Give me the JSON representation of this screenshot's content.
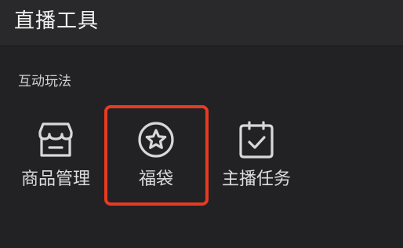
{
  "header": {
    "title": "直播工具"
  },
  "section": {
    "title": "互动玩法"
  },
  "tools": [
    {
      "label": "商品管理",
      "icon": "store-icon"
    },
    {
      "label": "福袋",
      "icon": "star-badge-icon"
    },
    {
      "label": "主播任务",
      "icon": "calendar-check-icon"
    }
  ],
  "colors": {
    "background": "#222224",
    "header_background": "#29292b",
    "text": "#dcdcdc",
    "highlight": "#e83a22"
  }
}
